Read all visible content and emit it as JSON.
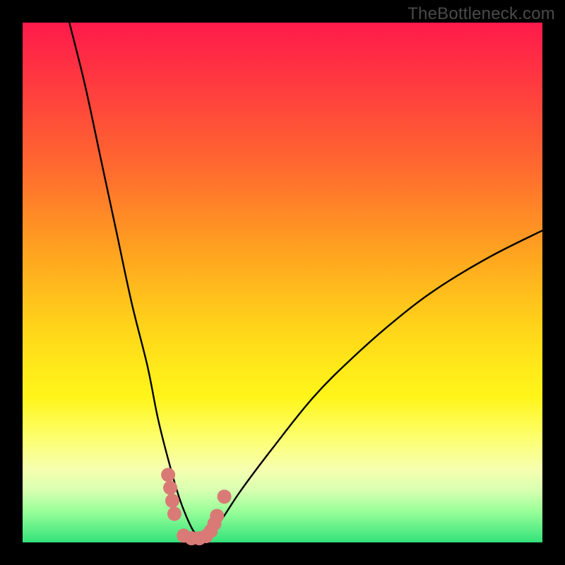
{
  "watermark": "TheBottleneck.com",
  "colors": {
    "frame": "#000000",
    "curve_stroke": "#000000",
    "marker_fill": "#d97a77",
    "marker_stroke": "#d97a77"
  },
  "chart_data": {
    "type": "line",
    "title": "",
    "xlabel": "",
    "ylabel": "",
    "xlim": [
      0,
      100
    ],
    "ylim": [
      0,
      100
    ],
    "grid": false,
    "legend": false,
    "series": [
      {
        "name": "bottleneck-curve",
        "x": [
          9,
          12,
          15,
          18,
          21,
          24,
          26,
          28,
          30,
          31.5,
          33,
          34.5,
          36,
          38,
          42,
          48,
          56,
          64,
          72,
          80,
          90,
          100
        ],
        "y": [
          100,
          88,
          74,
          60,
          46,
          34,
          24,
          16,
          9,
          5,
          2,
          1,
          2,
          4,
          10,
          18,
          28,
          36,
          43,
          49,
          55,
          60
        ]
      }
    ],
    "markers": [
      {
        "x": 28.0,
        "y": 13.0
      },
      {
        "x": 28.4,
        "y": 10.5
      },
      {
        "x": 28.8,
        "y": 8.0
      },
      {
        "x": 29.2,
        "y": 5.5
      },
      {
        "x": 31.0,
        "y": 1.3
      },
      {
        "x": 32.5,
        "y": 0.8
      },
      {
        "x": 34.0,
        "y": 0.8
      },
      {
        "x": 35.3,
        "y": 1.2
      },
      {
        "x": 36.2,
        "y": 2.2
      },
      {
        "x": 36.9,
        "y": 3.6
      },
      {
        "x": 37.4,
        "y": 5.1
      },
      {
        "x": 38.8,
        "y": 8.8
      }
    ]
  }
}
